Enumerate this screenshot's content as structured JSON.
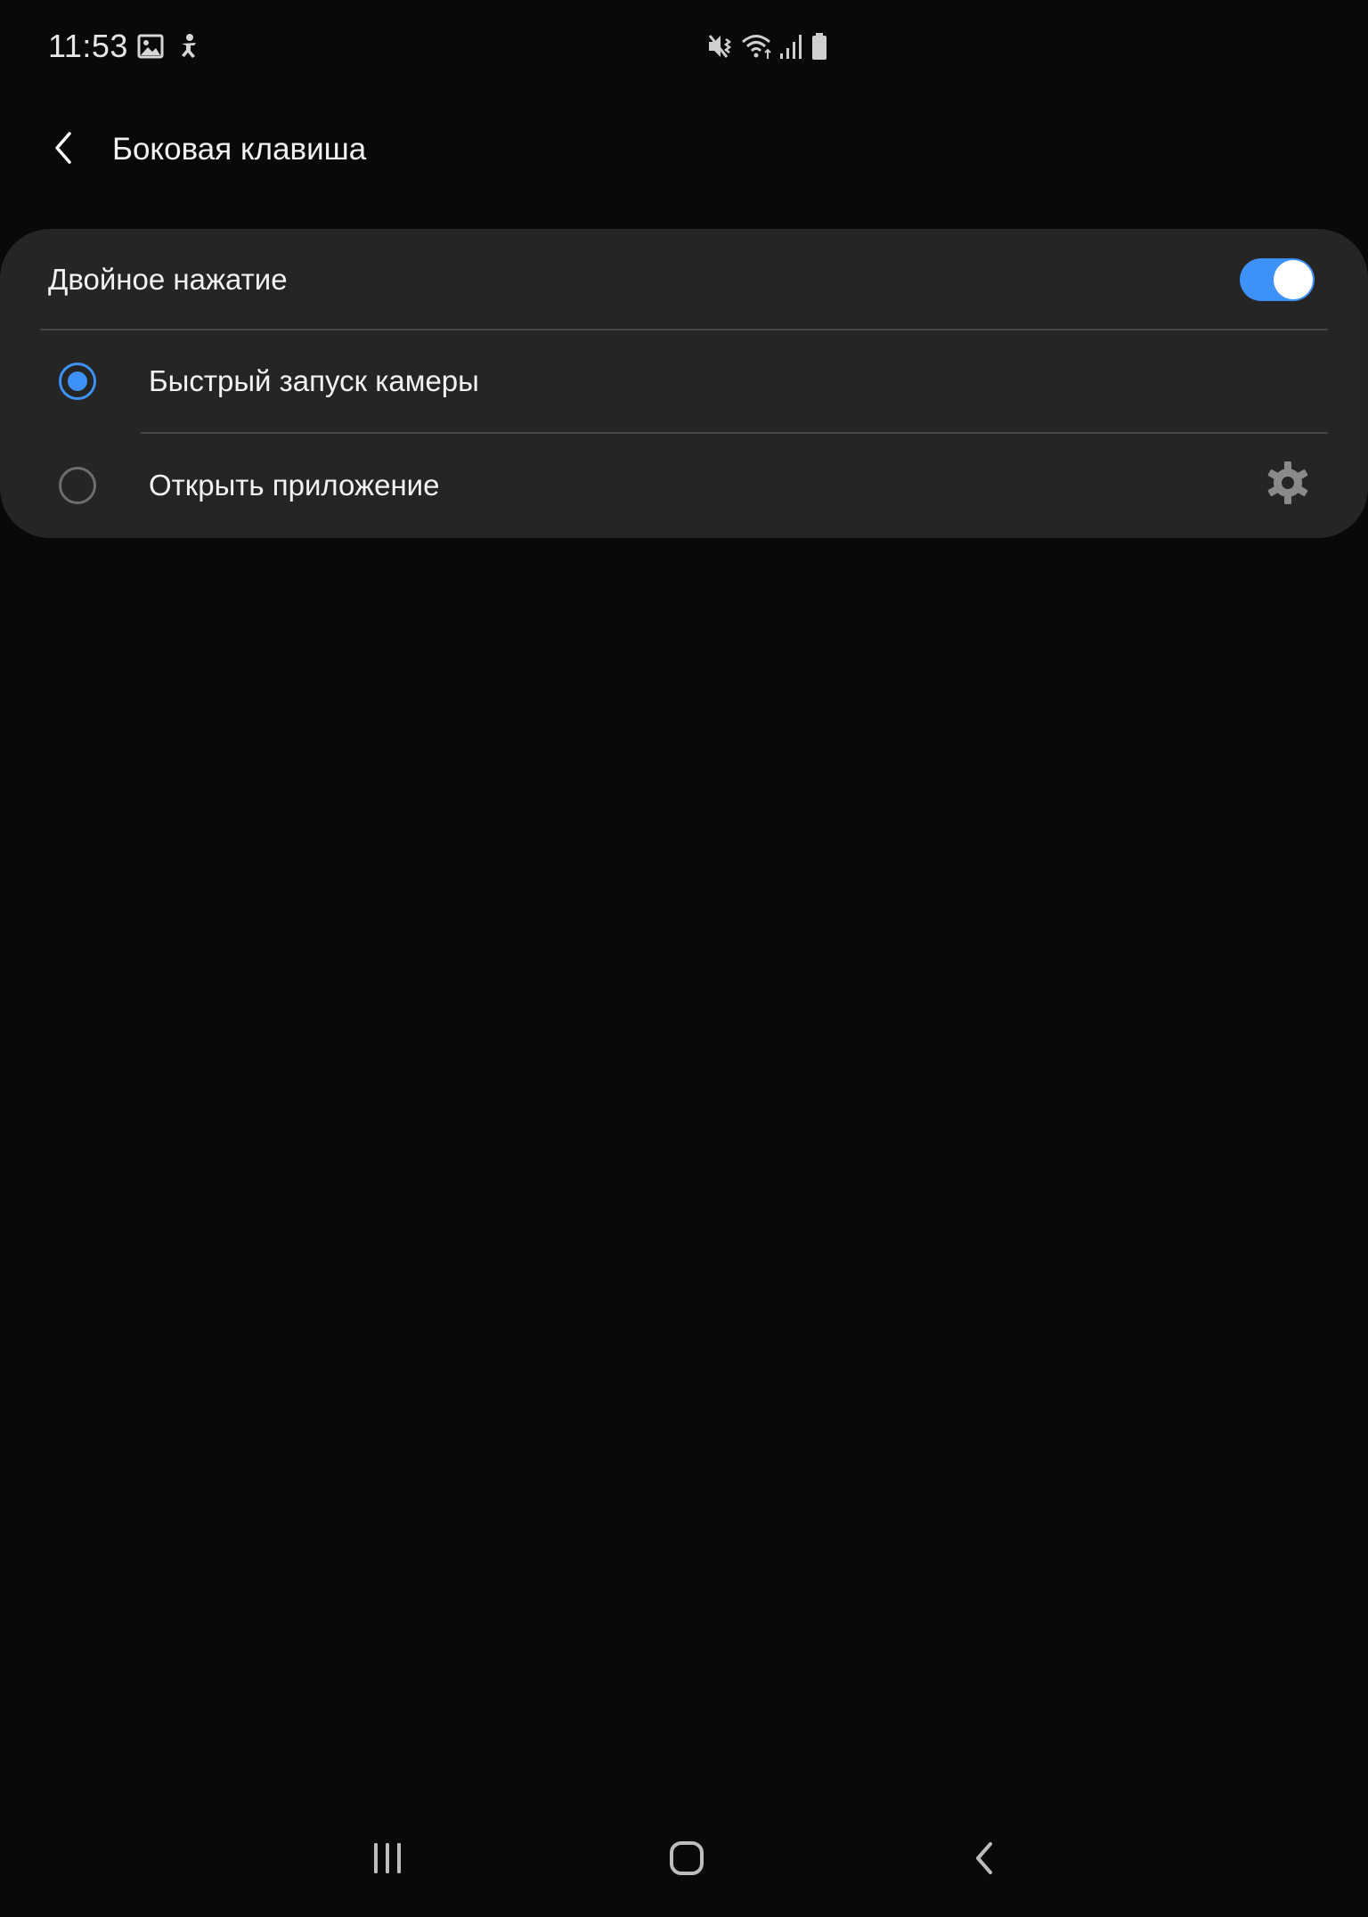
{
  "status_bar": {
    "time": "11:53",
    "left_icons": [
      "gallery-icon",
      "accessibility-icon"
    ],
    "right_icons": [
      "mute-vibrate-icon",
      "wifi-icon",
      "cellular-signal-icon",
      "battery-icon"
    ]
  },
  "header": {
    "back_icon": "back-arrow-icon",
    "title": "Боковая клавиша"
  },
  "card": {
    "master": {
      "label": "Двойное нажатие",
      "enabled": true
    },
    "options": [
      {
        "label": "Быстрый запуск камеры",
        "selected": true,
        "has_settings": false
      },
      {
        "label": "Открыть приложение",
        "selected": false,
        "has_settings": true,
        "settings_icon": "gear-icon"
      }
    ]
  },
  "nav_bar": {
    "buttons": [
      "recent-apps-icon",
      "home-icon",
      "back-icon"
    ]
  },
  "colors": {
    "background": "#090909",
    "card": "#252525",
    "accent": "#3e91f7",
    "divider": "#464646",
    "text": "#f2f2f2",
    "icon_muted": "#8a8a8a"
  }
}
